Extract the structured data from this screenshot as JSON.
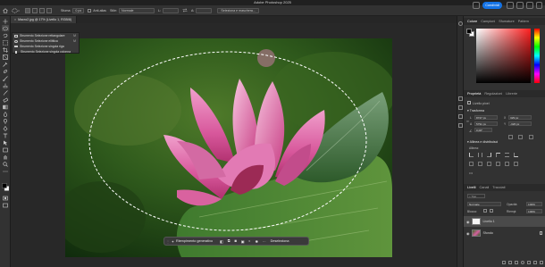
{
  "app": {
    "title": "Adobe Photoshop 2025"
  },
  "options_bar": {
    "sfumatura_label": "Sfuma:",
    "sfumatura_value": "0 px",
    "antialias_label": "Anti-alias",
    "stile_label": "Stile:",
    "stile_value": "Normale",
    "l_label": "L:",
    "a_label": "A:",
    "select_mask_label": "Seleziona e maschera...",
    "share_label": "Condividi"
  },
  "document": {
    "tab_title": "Macro2.jpg @ 17% (Livello 1, RGB/8)"
  },
  "tool_flyout": {
    "items": [
      {
        "label": "Strumento Selezione rettangolare",
        "shortcut": "M"
      },
      {
        "label": "Strumento Selezione ellittica",
        "shortcut": "M"
      },
      {
        "label": "Strumento Selezione singola riga",
        "shortcut": ""
      },
      {
        "label": "Strumento Selezione singola colonna",
        "shortcut": ""
      }
    ]
  },
  "context_bar": {
    "generative_fill_label": "Riempimento generativo",
    "deselect_label": "Deseleziona"
  },
  "color_panel": {
    "tabs": [
      "Colore",
      "Campioni",
      "Sfumature",
      "Pattern"
    ]
  },
  "properties_panel": {
    "tabs": [
      "Proprietà",
      "Regolazioni",
      "Librerie"
    ],
    "layer_type": "Livello pixel",
    "transform_label": "Trasforma",
    "w_label": "L",
    "w_value": "8727 px",
    "x_label": "X",
    "x_value": "329 px",
    "h_label": "A",
    "h_value": "5791 px",
    "y_label": "Y",
    "y_value": "-326 px",
    "angle_value": "0,00°",
    "align_label": "Allinea e distribuisci",
    "align_sub": "Allinea:"
  },
  "layers_panel": {
    "tabs": [
      "Livelli",
      "Canali",
      "Tracciati"
    ],
    "blend_mode": "Normale",
    "opacity_label": "Opacità:",
    "opacity_value": "100%",
    "lock_label": "Blocca:",
    "fill_label": "Riempi:",
    "fill_value": "100%",
    "layers": [
      {
        "name": "Livello 1",
        "selected": true
      },
      {
        "name": "Sfondo",
        "selected": false
      }
    ]
  },
  "colors": {
    "accent": "#1473e6",
    "panel_bg": "#323232",
    "canvas_bg": "#282828"
  }
}
